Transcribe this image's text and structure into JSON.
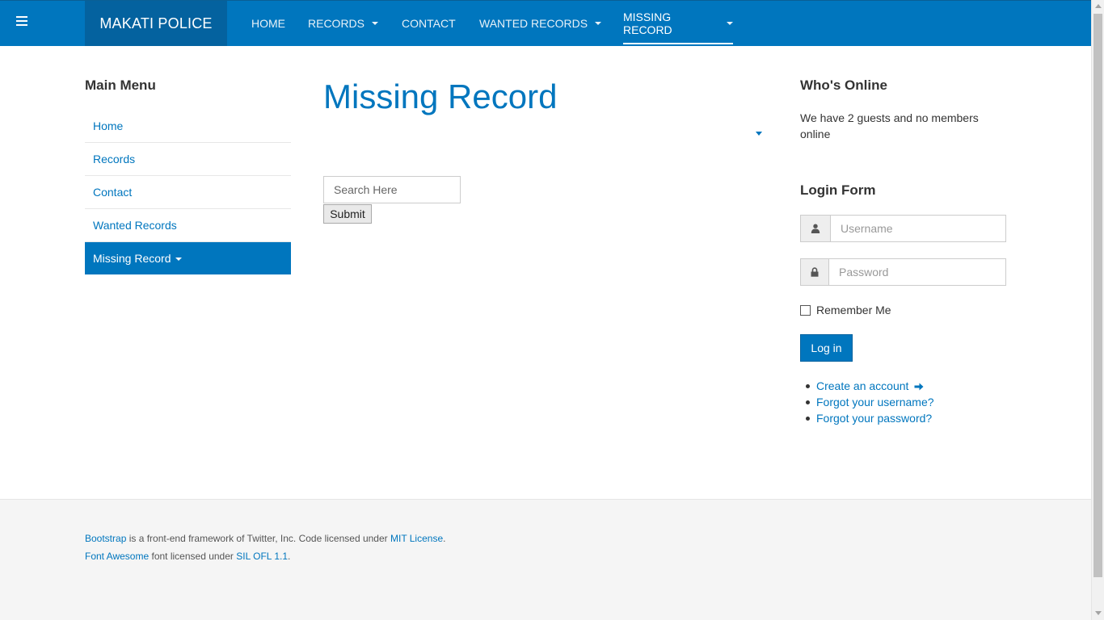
{
  "navbar": {
    "brand": "MAKATI POLICE",
    "items": [
      {
        "label": "HOME",
        "has_caret": false
      },
      {
        "label": "RECORDS",
        "has_caret": true
      },
      {
        "label": "CONTACT",
        "has_caret": false
      },
      {
        "label": "WANTED RECORDS",
        "has_caret": true
      },
      {
        "label": "MISSING RECORD",
        "has_caret": true,
        "active": true
      }
    ]
  },
  "sidebar": {
    "title": "Main Menu",
    "items": [
      {
        "label": "Home"
      },
      {
        "label": "Records"
      },
      {
        "label": "Contact"
      },
      {
        "label": "Wanted Records"
      },
      {
        "label": "Missing Record",
        "active": true
      }
    ]
  },
  "main": {
    "title": "Missing Record",
    "search_placeholder": "Search Here",
    "submit_label": "Submit"
  },
  "who_online": {
    "title": "Who's Online",
    "text": "We have 2 guests and no members online"
  },
  "login": {
    "title": "Login Form",
    "username_placeholder": "Username",
    "password_placeholder": "Password",
    "remember_label": "Remember Me",
    "login_label": "Log in",
    "links": {
      "create": "Create an account",
      "forgot_username": "Forgot your username?",
      "forgot_password": "Forgot your password?"
    }
  },
  "footer": {
    "line1": {
      "link1": "Bootstrap",
      "text1": " is a front-end framework of Twitter, Inc. Code licensed under ",
      "link2": "MIT License",
      "text2": "."
    },
    "line2": {
      "link1": "Font Awesome",
      "text1": " font licensed under ",
      "link2": "SIL OFL 1.1",
      "text2": "."
    }
  },
  "colors": {
    "accent": "#0076be",
    "brand_bg": "#04629f",
    "footer_bg": "#f5f5f5"
  },
  "icons": [
    "menu-icon",
    "user-icon",
    "lock-icon",
    "arrow-right-icon",
    "caret-down-icon"
  ]
}
